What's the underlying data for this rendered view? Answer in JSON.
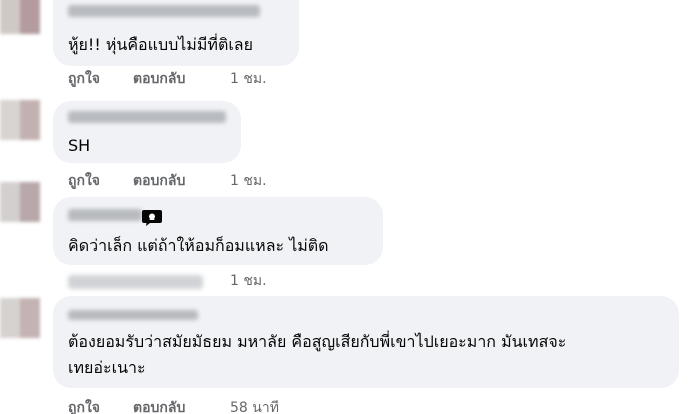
{
  "comments": [
    {
      "text": "หู้ย!! หุ่นคือแบบไม่มีที่ติเลย",
      "actions": {
        "like": "ถูกใจ",
        "reply": "ตอบกลับ",
        "time": "1 ชม."
      }
    },
    {
      "text": "SH",
      "actions": {
        "like": "ถูกใจ",
        "reply": "ตอบกลับ",
        "time": "1 ชม."
      }
    },
    {
      "text": "คิดว่าเล็ก แต่ถ้าให้อมก็อมแหละ ไม่ติด",
      "actions": {
        "time": "1 ชม."
      }
    },
    {
      "text_line1": "ต้องยอมรับว่าสมัยมัธยม มหาลัย คือสูญเสียกับพี่เขาไปเยอะมาก มันเทสจะ",
      "text_line2": "เทยอ่ะเนาะ",
      "actions": {
        "like": "ถูกใจ",
        "reply": "ตอบกลับ",
        "time": "58 นาที"
      }
    }
  ],
  "icons": {
    "comment_badge": "speech-bubble-icon"
  },
  "colors": {
    "bubble_bg": "#f0f2f5",
    "text": "#050505",
    "secondary": "#65676b"
  }
}
